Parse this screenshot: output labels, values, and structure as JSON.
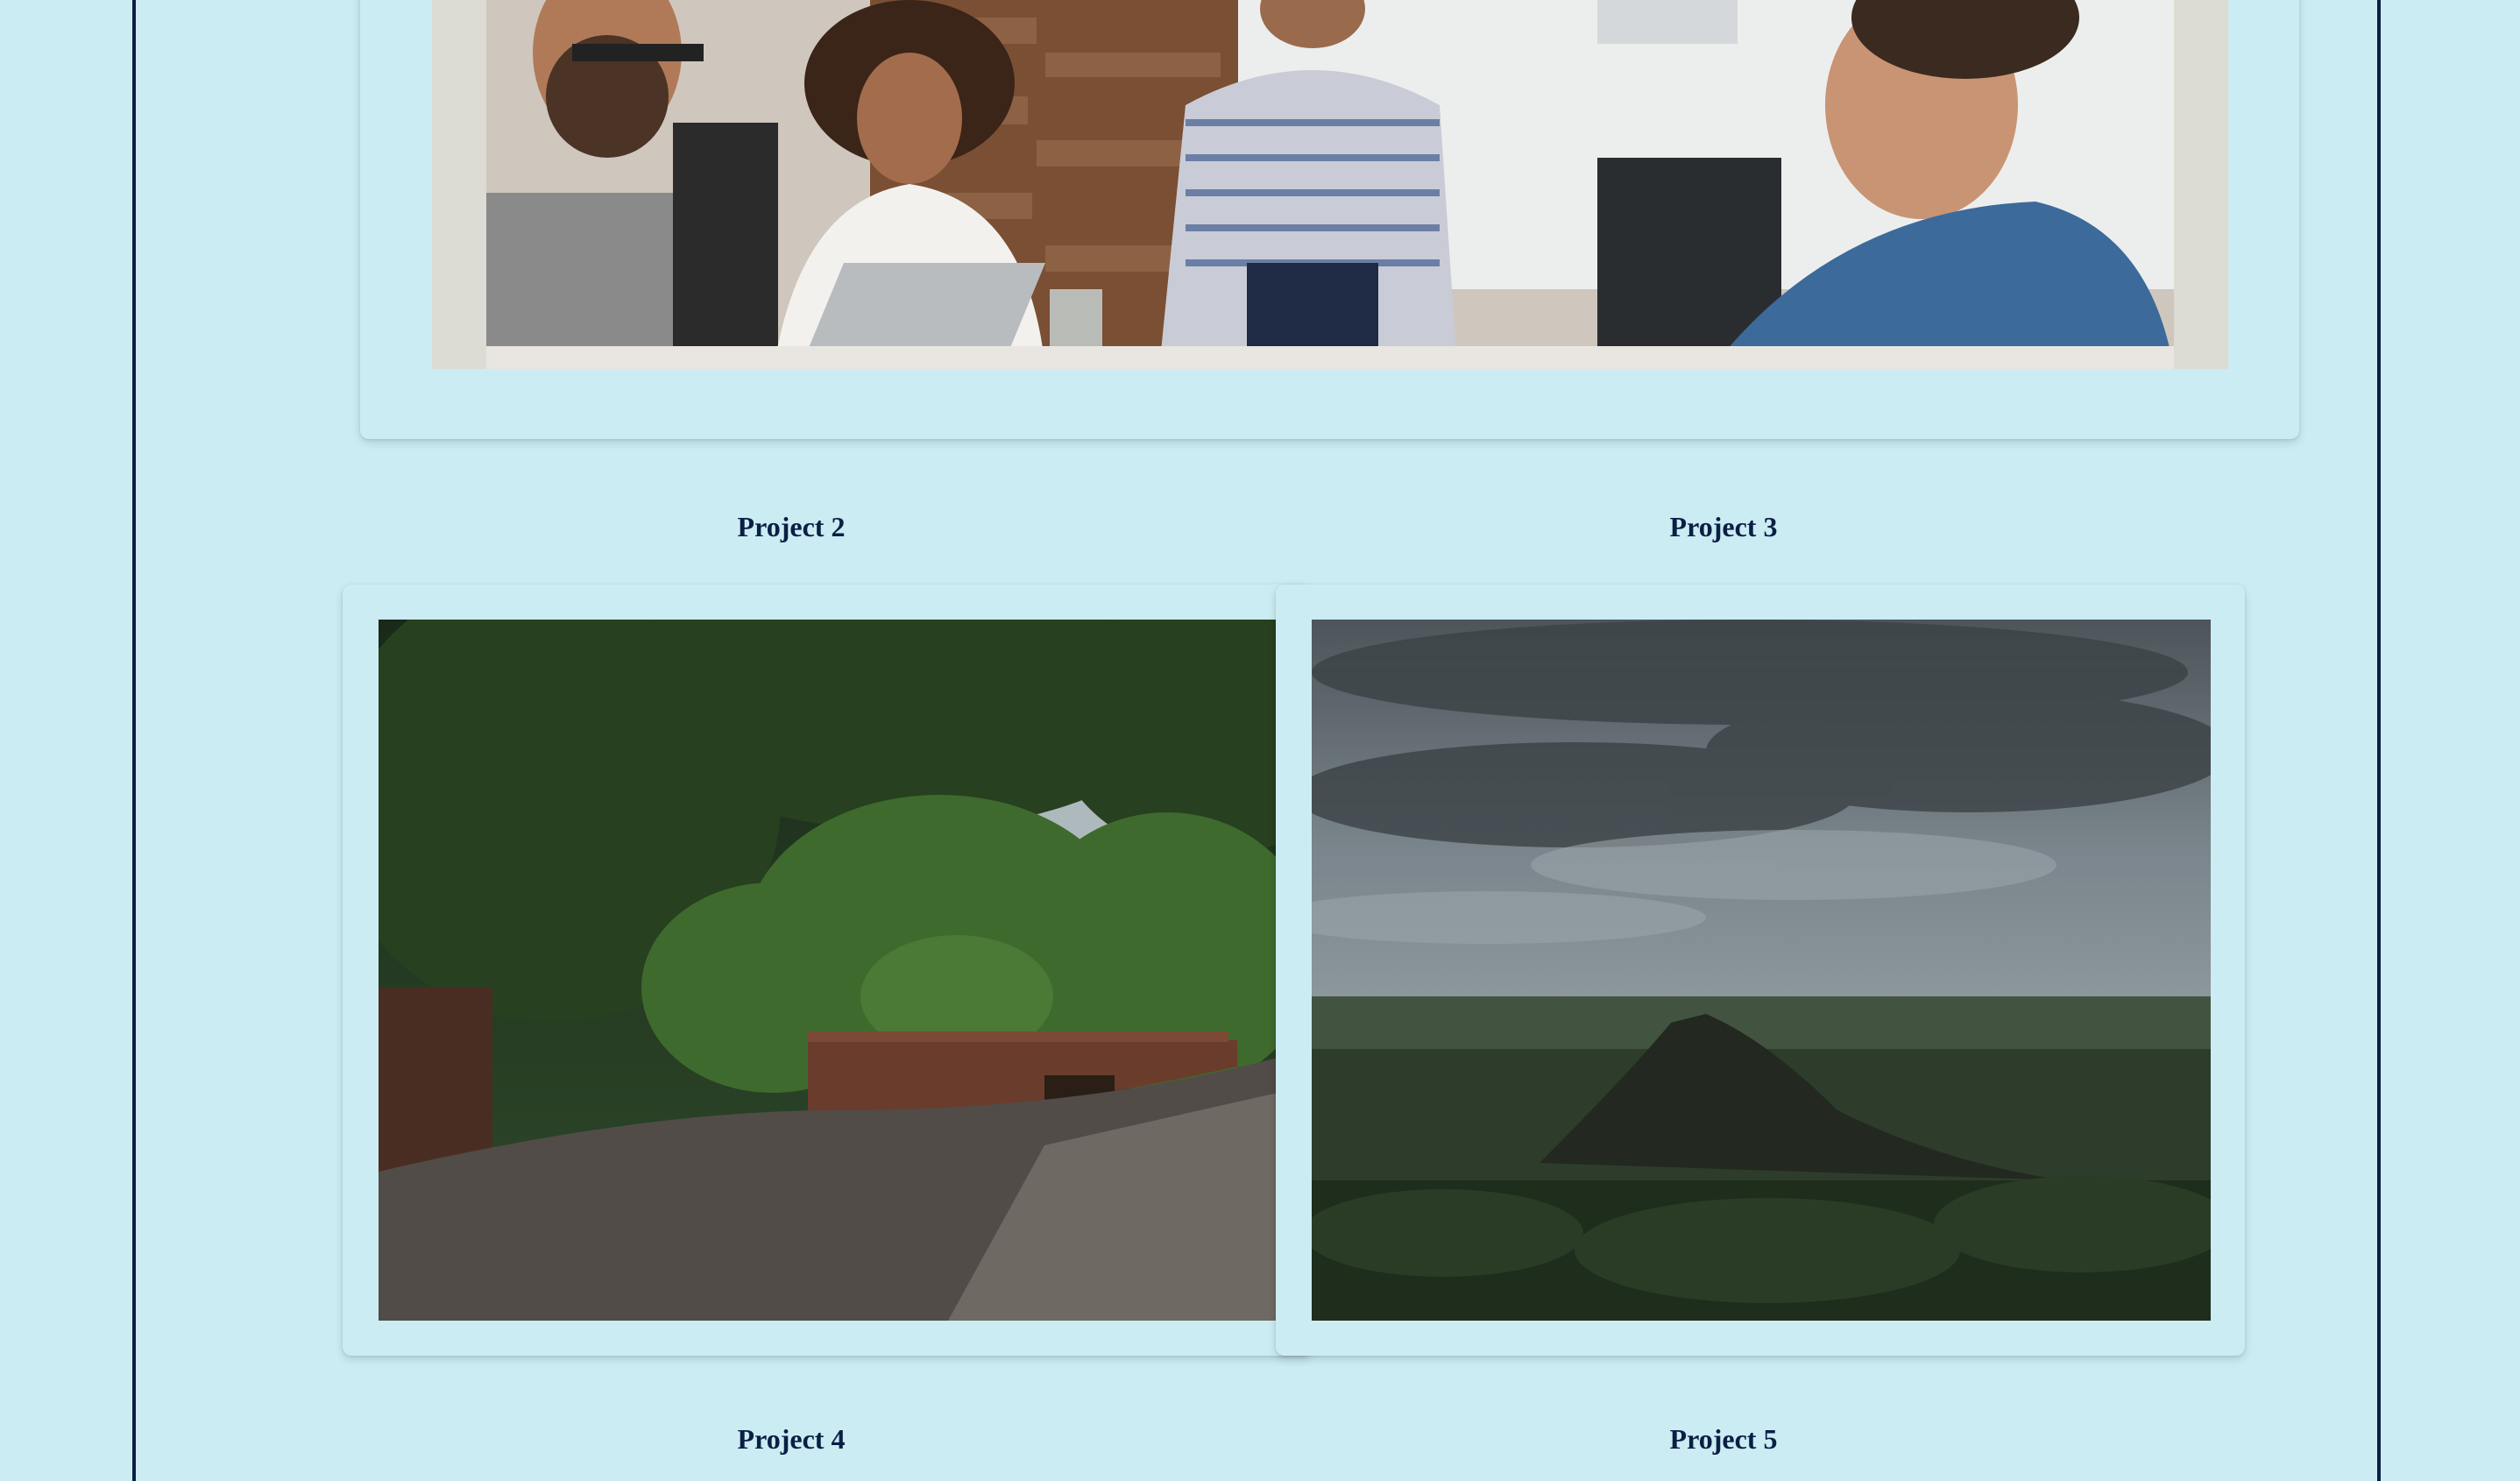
{
  "projects": [
    {
      "title": "Project 2",
      "image": "tree-lined-path-photo"
    },
    {
      "title": "Project 3",
      "image": "mountain-landscape-photo"
    },
    {
      "title": "Project 4"
    },
    {
      "title": "Project 5"
    }
  ],
  "featured": {
    "image": "team-meeting-photo"
  },
  "colors": {
    "page_bg": "#cbecf3",
    "border": "#0b1f44",
    "title_text": "#0b1f44"
  }
}
